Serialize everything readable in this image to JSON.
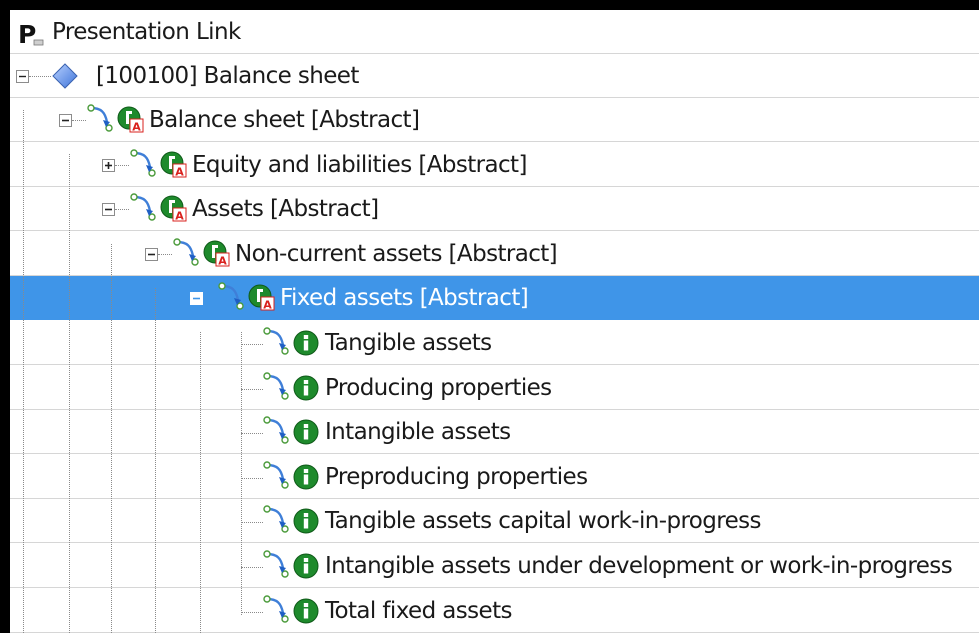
{
  "header": {
    "title": "Presentation Link",
    "icon": "presentation-p-icon"
  },
  "tree": {
    "root": {
      "label": "[100100] Balance sheet",
      "icon": "diamond-icon",
      "expanded": true
    },
    "nodes": [
      {
        "label": "Balance sheet [Abstract]",
        "type": "abstract",
        "expanded": true
      },
      {
        "label": "Equity and liabilities [Abstract]",
        "type": "abstract",
        "expanded": false
      },
      {
        "label": "Assets [Abstract]",
        "type": "abstract",
        "expanded": true
      },
      {
        "label": "Non-current assets [Abstract]",
        "type": "abstract",
        "expanded": true
      },
      {
        "label": "Fixed assets [Abstract]",
        "type": "abstract",
        "expanded": true,
        "selected": true
      },
      {
        "label": "Tangible assets",
        "type": "item"
      },
      {
        "label": "Producing properties",
        "type": "item"
      },
      {
        "label": "Intangible assets",
        "type": "item"
      },
      {
        "label": "Preproducing properties",
        "type": "item"
      },
      {
        "label": "Tangible assets capital work-in-progress",
        "type": "item"
      },
      {
        "label": "Intangible assets under development or work-in-progress",
        "type": "item"
      },
      {
        "label": "Total fixed assets",
        "type": "item"
      }
    ]
  },
  "colors": {
    "selection": "#3f95e8",
    "element_icon": "#1e8a2c",
    "abstract_badge": "#d9211d",
    "diamond": "#5a8fe8"
  }
}
